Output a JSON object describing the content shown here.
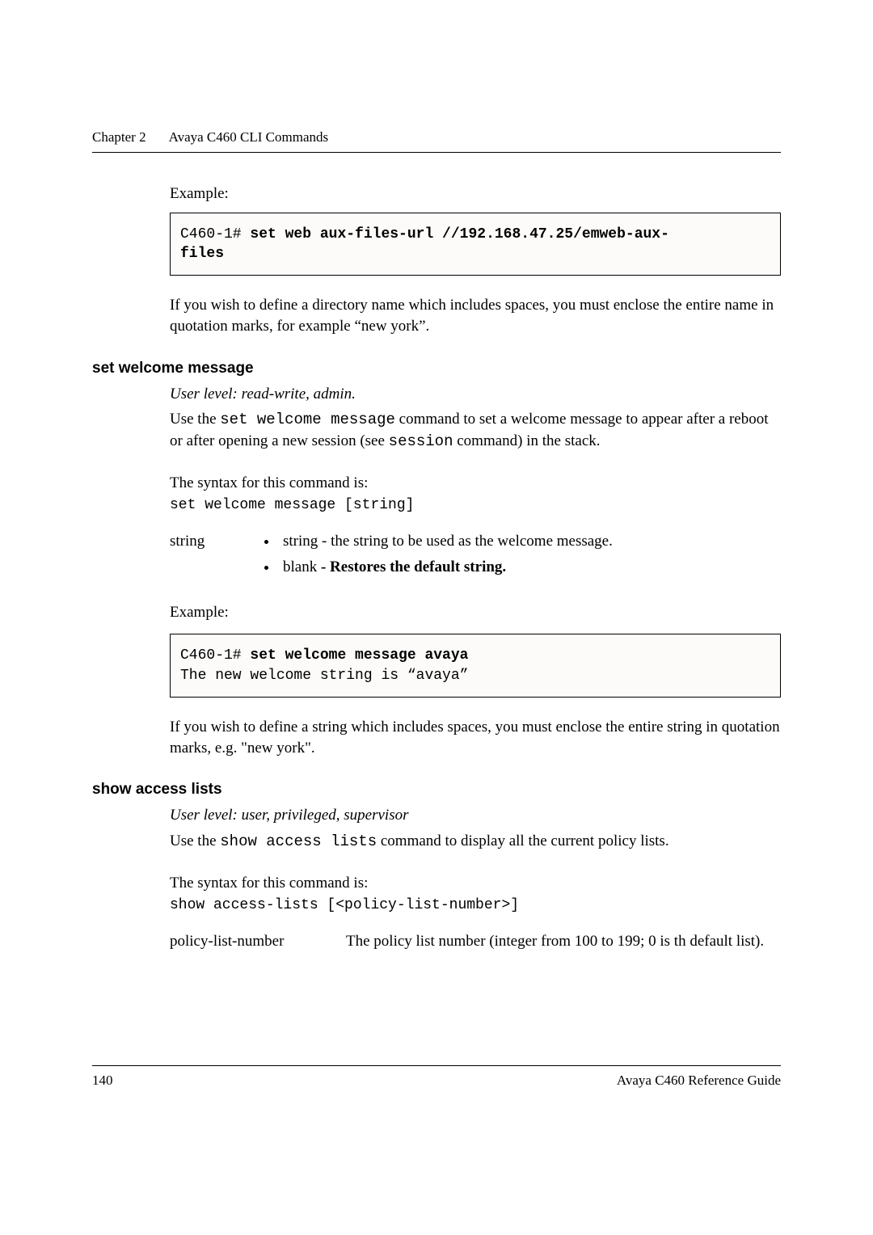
{
  "header": {
    "chapter": "Chapter 2",
    "title": "Avaya C460 CLI Commands"
  },
  "sec0": {
    "example_label": "Example:",
    "code_prompt": "C460-1# ",
    "code_cmd_l1": "set web aux-files-url //192.168.47.25/emweb-aux-",
    "code_cmd_l2": "files",
    "note": "If you wish to define a directory name which includes spaces, you must enclose the entire name in quotation marks, for example “new york”."
  },
  "sec1": {
    "heading": "set welcome message",
    "userlevel": "User level: read-write, admin.",
    "desc_a": "Use the ",
    "desc_code1": "set welcome message",
    "desc_b": " command to set a welcome message to appear after a reboot or after opening a new session (see ",
    "desc_code2": "session",
    "desc_c": " command) in the stack.",
    "syntax_label": "The syntax for this command is:",
    "syntax_code": "set welcome message [string]",
    "param_name": "string",
    "bullet1": "string - the string to be used as the welcome message.",
    "bullet2_a": "blank",
    "bullet2_b": " - Restores the default string.",
    "example_label": "Example:",
    "code_prompt": "C460-1# ",
    "code_cmd": "set welcome message avaya",
    "code_out": "The new welcome string is “avaya”",
    "note": "If you wish to define a string which includes spaces, you must enclose the entire string in quotation marks, e.g. \"new york\"."
  },
  "sec2": {
    "heading": "show access lists",
    "userlevel": "User level: user, privileged, supervisor",
    "desc_a": "Use the ",
    "desc_code1": "show access lists",
    "desc_b": " command to display all the current policy lists.",
    "syntax_label": "The syntax for this command is:",
    "syntax_code": "show access-lists [<policy-list-number>]",
    "param_name": "policy-list-number",
    "param_desc": "The policy list number (integer from 100 to 199; 0 is th default list)."
  },
  "footer": {
    "page": "140",
    "doc": "Avaya C460 Reference Guide"
  }
}
